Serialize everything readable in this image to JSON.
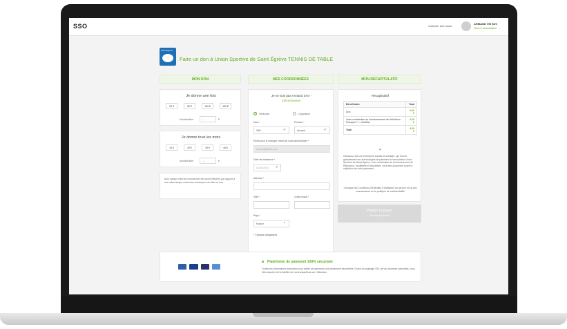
{
  "topbar": {
    "logo": "SSO",
    "link": "Collecter des fonds",
    "user_name": "ARMAND VM SDV",
    "user_sub": "Gérer l'association →"
  },
  "header": {
    "logo_text": "Saint Égrève",
    "title": "Faire un don à Union Sportive de Saint Égrève TENNIS DE TABLE"
  },
  "columns": {
    "donation": "MON DON",
    "details": "MES COORDONNÉES",
    "summary": "MON RÉCAPITULATIF"
  },
  "donation": {
    "once_title": "Je donne une fois",
    "once_amounts": [
      "20 €",
      "50 €",
      "100 €",
      "150 €"
    ],
    "once_free_label": "Montant libre",
    "once_free_value": "—",
    "currency": "€",
    "monthly_title": "Je donne tous les mois",
    "monthly_amounts": [
      "10 €",
      "20 €",
      "30 €",
      "40 €"
    ],
    "monthly_free_label": "Montant libre",
    "monthly_free_value": "—",
    "note": "Mon dossier vient de commencer des sport-Stéphen par rapport à ses votes temps, mais vous remarquez de faire un don"
  },
  "details": {
    "not_me": "Je ne suis pas Armand SAV -",
    "logout": "Déconnexion",
    "type_particular": "Particulier",
    "type_org": "Organisme",
    "name_label": "Nom *",
    "name_value": "SAV",
    "firstname_label": "Prénom *",
    "firstname_value": "Armand",
    "email_label": "Email pour le changer, merci de vous déconnecter *",
    "email_value": "armand@hello.com",
    "birth_label": "Date de naissance *",
    "birth_value": "01/04/2003",
    "address_label": "Adresse *",
    "city_label": "Ville *",
    "zip_label": "Code postal *",
    "country_label": "Pays *",
    "country_value": "France",
    "required": "* Champs obligatoires"
  },
  "summary": {
    "title": "Récapitulatif",
    "table_headers": [
      "Bénéficiaire",
      "Total"
    ],
    "rows": [
      {
        "label": "Don",
        "value": "0,00 €"
      },
      {
        "label": "Votre contribution au fonctionnement de HelloAsso. Pourquoi ? — Modifier",
        "value": "0,00 €"
      },
      {
        "label": "Total",
        "value": "0,00 €"
      }
    ],
    "text": "HelloAsso est une entreprise sociale et solidaire, qui fournit gratuitement ses technologies de paiement à l'association Union Sportive de Saint-Egrève. Une contribution au fonctionnement de HelloAsso, modifiable et facultative, vous sera proposée avant la validation de votre paiement.",
    "terms": "J'accepte les Conditions Générales d'Utilisation du service et j'ai pris connaissance de la politique de confidentialité",
    "submit_label": "Valider et payer",
    "submit_sub": "Paiement sécurisé"
  },
  "payment": {
    "title": "Plateforme de paiement 100% sécurisée",
    "text": "Toutes les informations bancaires pour traiter ce paiement sont totalement sécurisées. Grâce au cryptage SSL de vos données bancaires, vous êtes assurés de la fiabilité de vos transactions sur HelloAsso.",
    "cards": [
      "CB",
      "VISA",
      "MC",
      "SEPA"
    ],
    "colors": [
      "#2f5ea8",
      "#1a3f8f",
      "#2a2f6e",
      "#5a8fd0"
    ]
  },
  "theme": {
    "accent": "#64ad1e",
    "bezel": "#1a1a1a"
  }
}
